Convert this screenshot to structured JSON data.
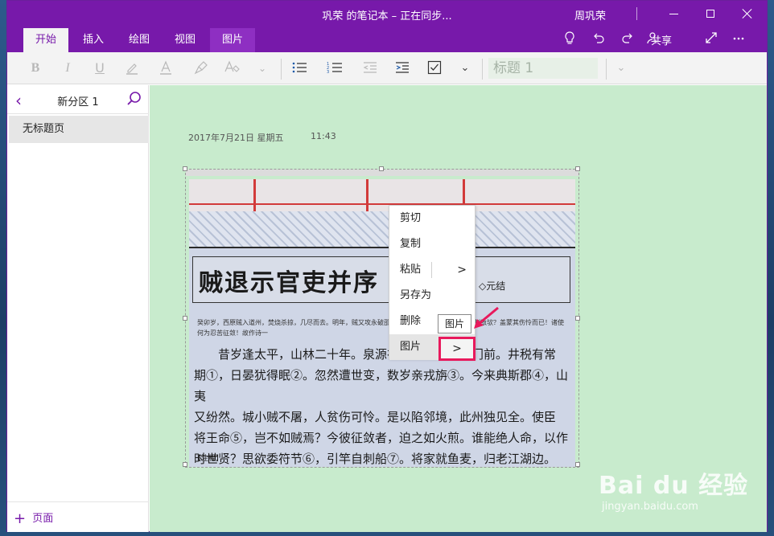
{
  "window": {
    "title": "巩荣 的笔记本 – 正在同步...",
    "user": "周巩荣"
  },
  "ribbon": {
    "tabs": [
      {
        "label": "开始",
        "active": true
      },
      {
        "label": "插入"
      },
      {
        "label": "绘图"
      },
      {
        "label": "视图"
      },
      {
        "label": "图片"
      }
    ],
    "share_label": "共享",
    "right_icons": [
      "lightbulb-icon",
      "undo-icon",
      "redo-icon",
      "share-person-icon",
      "expand-icon",
      "more-icon"
    ]
  },
  "toolbar": {
    "bold": "B",
    "italic": "I",
    "underline": "U",
    "style_value": "标题 1"
  },
  "sidebar": {
    "section_name": "新分区 1",
    "pages": [
      {
        "label": "无标题页"
      }
    ],
    "add_page_label": "页面"
  },
  "page": {
    "date": "2017年7月21日  星期五",
    "time": "11:43"
  },
  "image_text": {
    "title": "贼退示官吏并序",
    "author": "◇元结",
    "preface": "癸卯岁，西原贼入道州，焚烧杀掠，几尽而去。明年，贼又攻永破邵，不犯此州边鄙而退，岂力能制敌欤？盖蒙其伤怜而已！诸使何为忍苦征敛！故作诗一",
    "poem_lines": [
      "昔岁逢太平，山林二十年。泉源在庭户，洞壑当门前。井税有常",
      "期①，日晏犹得眠②。忽然遭世变，数岁亲戎旃③。今来典斯郡④，山夷",
      "又纷然。城小贼不屠，人贫伤可怜。是以陷邻境，此州独见全。使臣",
      "将王命⑤，岂不如贼焉？今彼征敛者，迫之如火煎。谁能绝人命，以作",
      "时世贤？思欲委符节⑥，引竿自刺船⑦。将家就鱼麦，归老江湖边。"
    ],
    "note": "【注释】"
  },
  "context_menu": {
    "items": [
      {
        "label": "剪切"
      },
      {
        "label": "复制"
      },
      {
        "label": "粘贴",
        "has_submenu": true
      },
      {
        "label": "另存为"
      },
      {
        "label": "删除"
      },
      {
        "label": "图片",
        "has_submenu": true
      }
    ],
    "submenu_arrow": ">",
    "tooltip": "图片"
  },
  "watermark": {
    "main": "Bai du 经验",
    "sub": "jingyan.baidu.com"
  },
  "colors": {
    "accent": "#7719aa",
    "canvas": "#c8ebcd",
    "highlight": "#e8195c"
  }
}
